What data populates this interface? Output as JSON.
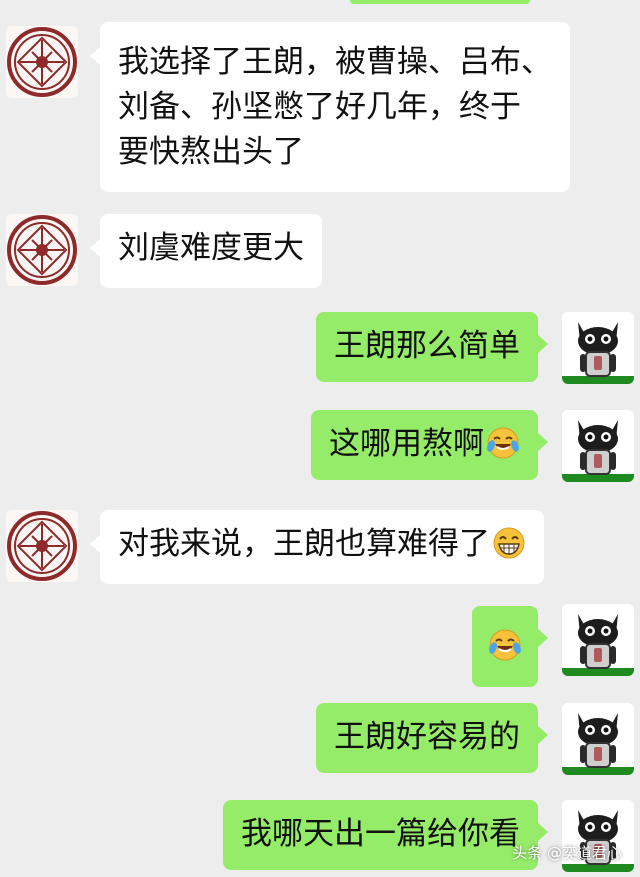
{
  "colors": {
    "background": "#ededed",
    "incoming_bubble": "#ffffff",
    "outgoing_bubble": "#95ec69"
  },
  "messages": [
    {
      "side": "left",
      "lines": [
        "我选择了王朗，被曹操、吕布、",
        "刘备、孙坚憋了好几年，终于",
        "要快熬出头了"
      ]
    },
    {
      "side": "left",
      "lines": [
        "刘虞难度更大"
      ]
    },
    {
      "side": "right",
      "lines": [
        "王朗那么简单"
      ]
    },
    {
      "side": "right",
      "lines": [
        "这哪用熬啊"
      ],
      "emoji": "laugh-cry-emoji"
    },
    {
      "side": "left",
      "lines": [
        "对我来说，王朗也算难得了"
      ],
      "emoji": "grin-emoji"
    },
    {
      "side": "right",
      "lines": [
        ""
      ],
      "emoji": "laugh-cry-emoji"
    },
    {
      "side": "right",
      "lines": [
        "王朗好容易的"
      ]
    },
    {
      "side": "right",
      "lines": [
        "我哪天出一篇给你看"
      ]
    }
  ],
  "watermark": "头条 @奕道君心"
}
